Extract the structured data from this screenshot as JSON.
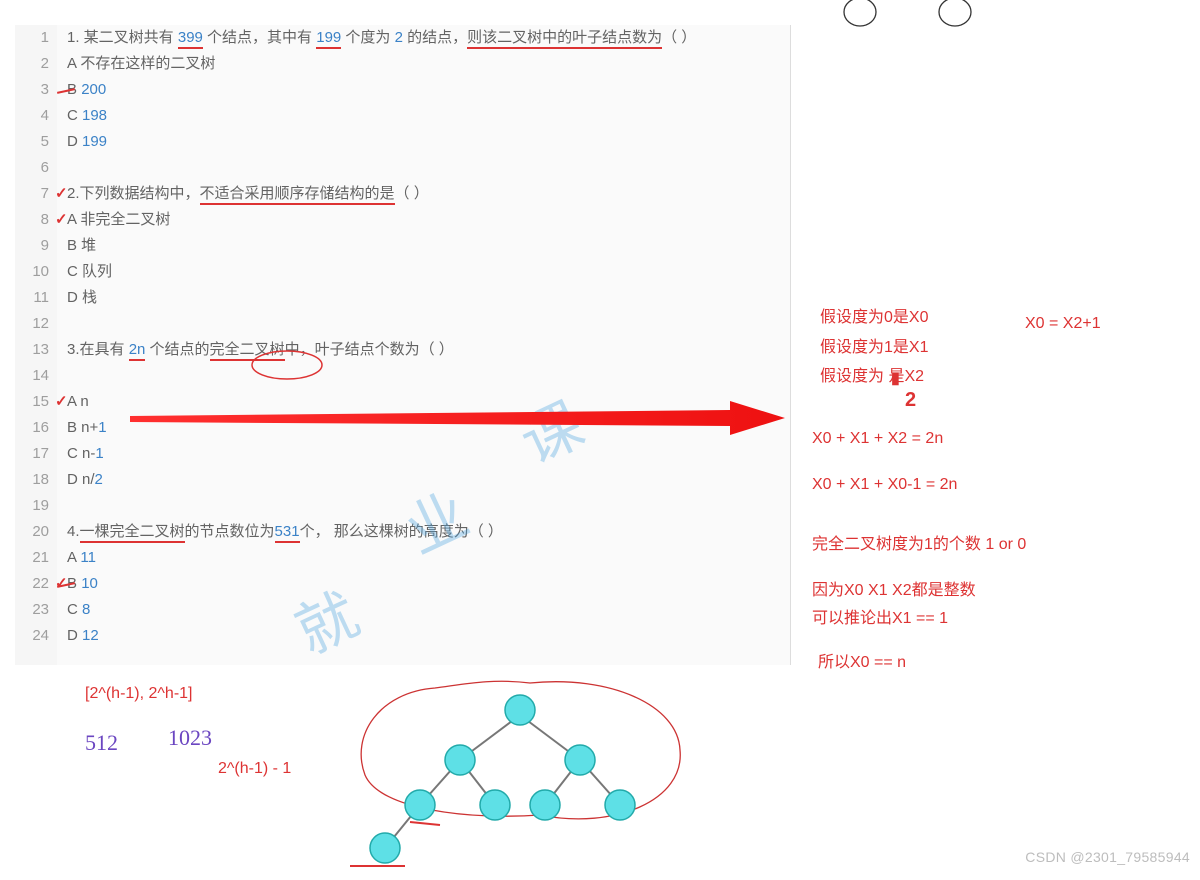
{
  "lines": [
    {
      "n": 1,
      "text": "1. 某二叉树共有 399 个结点，其中有 199 个度为 2 的结点，则该二叉树中的叶子结点数为（ ）",
      "segments": [
        [
          "1. 某二叉树共有 ",
          ""
        ],
        [
          "399",
          "num underline"
        ],
        [
          " 个结点，其中有 ",
          ""
        ],
        [
          "199",
          "num underline"
        ],
        [
          " 个度为 ",
          ""
        ],
        [
          "2",
          "num"
        ],
        [
          " 的结点，",
          ""
        ],
        [
          "则该二叉树中的叶子结点数为",
          "underline"
        ],
        [
          "（ ）",
          ""
        ]
      ]
    },
    {
      "n": 2,
      "text": "A 不存在这样的二叉树"
    },
    {
      "n": 3,
      "text": "B 200",
      "segments": [
        [
          "B ",
          ""
        ],
        [
          "200",
          "num"
        ]
      ],
      "strike": true
    },
    {
      "n": 4,
      "text": "C 198",
      "segments": [
        [
          "C ",
          ""
        ],
        [
          "198",
          "num"
        ]
      ]
    },
    {
      "n": 5,
      "text": "D 199",
      "segments": [
        [
          "D ",
          ""
        ],
        [
          "199",
          "num"
        ]
      ]
    },
    {
      "n": 6,
      "text": ""
    },
    {
      "n": 7,
      "text": "2.下列数据结构中，不适合采用顺序存储结构的是（ ）",
      "segments": [
        [
          "2.下列数据结构中，",
          ""
        ],
        [
          "不适合采用顺序存储结构的是",
          "underline"
        ],
        [
          "（ ）",
          ""
        ]
      ],
      "tick": true
    },
    {
      "n": 8,
      "text": "A 非完全二叉树",
      "tick": true
    },
    {
      "n": 9,
      "text": "B 堆"
    },
    {
      "n": 10,
      "text": "C 队列"
    },
    {
      "n": 11,
      "text": "D 栈"
    },
    {
      "n": 12,
      "text": ""
    },
    {
      "n": 13,
      "text": "3.在具有 2n 个结点的完全二叉树中，叶子结点个数为（ ）",
      "segments": [
        [
          "3.在具有 ",
          ""
        ],
        [
          "2n",
          "num underline"
        ],
        [
          " 个结点的",
          ""
        ],
        [
          "完全二叉树",
          "underline"
        ],
        [
          "中，叶子结点个数为（ ）",
          ""
        ]
      ]
    },
    {
      "n": 14,
      "text": ""
    },
    {
      "n": 15,
      "text": "A n",
      "tick": true
    },
    {
      "n": 16,
      "text": "B n+1",
      "segments": [
        [
          "B n+",
          ""
        ],
        [
          "1",
          "num"
        ]
      ]
    },
    {
      "n": 17,
      "text": "C n-1",
      "segments": [
        [
          "C n-",
          ""
        ],
        [
          "1",
          "num"
        ]
      ]
    },
    {
      "n": 18,
      "text": "D n/2",
      "segments": [
        [
          "D n/",
          ""
        ],
        [
          "2",
          "num"
        ]
      ]
    },
    {
      "n": 19,
      "text": ""
    },
    {
      "n": 20,
      "text": "4.一棵完全二叉树的节点数位为531个，那么这棵树的高度为（ ）",
      "segments": [
        [
          "4.",
          ""
        ],
        [
          "一棵完全二叉树",
          "underline"
        ],
        [
          "的节点数位为",
          ""
        ],
        [
          "531",
          "num underline"
        ],
        [
          "个，",
          ""
        ],
        [
          " 那么这棵树的高度为（ ）",
          ""
        ]
      ]
    },
    {
      "n": 21,
      "text": "A 11",
      "segments": [
        [
          "A ",
          ""
        ],
        [
          "11",
          "num"
        ]
      ]
    },
    {
      "n": 22,
      "text": "B 10",
      "segments": [
        [
          "B ",
          ""
        ],
        [
          "10",
          "num"
        ]
      ],
      "tick": true,
      "strike": true
    },
    {
      "n": 23,
      "text": "C 8",
      "segments": [
        [
          "C ",
          ""
        ],
        [
          "8",
          "num"
        ]
      ]
    },
    {
      "n": 24,
      "text": "D 12",
      "segments": [
        [
          "D ",
          ""
        ],
        [
          "12",
          "num"
        ]
      ]
    }
  ],
  "notes": [
    "假设度为0是X0",
    "假设度为1是X1",
    "假设度为  是X2"
  ],
  "two_anno": "2",
  "eqn": "X0 = X2+1",
  "formulas": [
    "X0 + X1 + X2 = 2n",
    "X0 + X1 + X0-1 = 2n",
    "完全二叉树度为1的个数 1 or 0",
    "因为X0 X1 X2都是整数",
    "可以推论出X1 == 1",
    "所以X0 == n"
  ],
  "range_formula": "[2^(h-1), 2^h-1]",
  "full_minus": "2^(h-1) - 1",
  "hand_nums": [
    "512",
    "1023"
  ],
  "csdn": "CSDN @2301_79585944",
  "watermark": [
    "课",
    "业",
    "就"
  ],
  "icons": {
    "circle_top_left": "tree-node",
    "circle_top_right": "tree-node"
  }
}
